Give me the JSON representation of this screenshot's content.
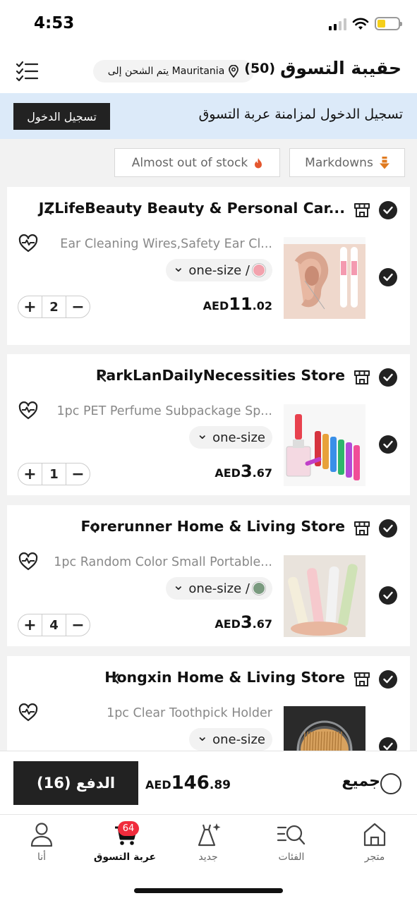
{
  "status_bar": {
    "time": "4:53"
  },
  "header": {
    "title": "حقيبة التسوق",
    "count": "(50)",
    "shipping_text": "يتم الشحن إلى Mauritania"
  },
  "login_banner": {
    "text": "تسجيل الدخول لمزامنة عربة التسوق",
    "button_label": "تسجيل الدخول"
  },
  "filters": [
    {
      "label": "Almost out of stock",
      "icon": "flame-icon"
    },
    {
      "label": "Markdowns",
      "icon": "arrow-down-icon"
    }
  ],
  "stores": [
    {
      "name": "JZLifeBeauty Beauty & Personal Car...",
      "item": {
        "title": "Ear Cleaning Wires,Safety Ear Cl...",
        "variant": "one-size /",
        "swatch_color": "#f2a2ad",
        "currency": "AED",
        "price_int": "11",
        "price_dec": ".02",
        "quantity": "2"
      }
    },
    {
      "name": "ParkLanDailyNecessities Store",
      "item": {
        "title": "1pc PET Perfume Subpackage Sp...",
        "variant": "one-size",
        "currency": "AED",
        "price_int": "3",
        "price_dec": ".67",
        "quantity": "1"
      }
    },
    {
      "name": "Forerunner Home & Living Store",
      "item": {
        "title": "1pc Random Color Small Portable...",
        "variant": "one-size /",
        "swatch_color": "#7a9a7f",
        "currency": "AED",
        "price_int": "3",
        "price_dec": ".67",
        "quantity": "4"
      }
    },
    {
      "name": "Hongxin Home & Living Store",
      "item": {
        "title": "1pc Clear Toothpick Holder",
        "variant": "one-size"
      }
    }
  ],
  "checkout": {
    "pay_label": "الدفع (16)",
    "currency": "AED",
    "total_int": "146",
    "total_dec": ".89",
    "select_all_label": "جميع"
  },
  "nav": [
    {
      "label": "أنا",
      "icon": "person-icon"
    },
    {
      "label": "عربة التسوق",
      "icon": "cart-icon",
      "badge": "64",
      "active": true
    },
    {
      "label": "جديد",
      "icon": "dress-sparkle-icon"
    },
    {
      "label": "الفئات",
      "icon": "categories-search-icon"
    },
    {
      "label": "متجر",
      "icon": "home-icon"
    }
  ]
}
